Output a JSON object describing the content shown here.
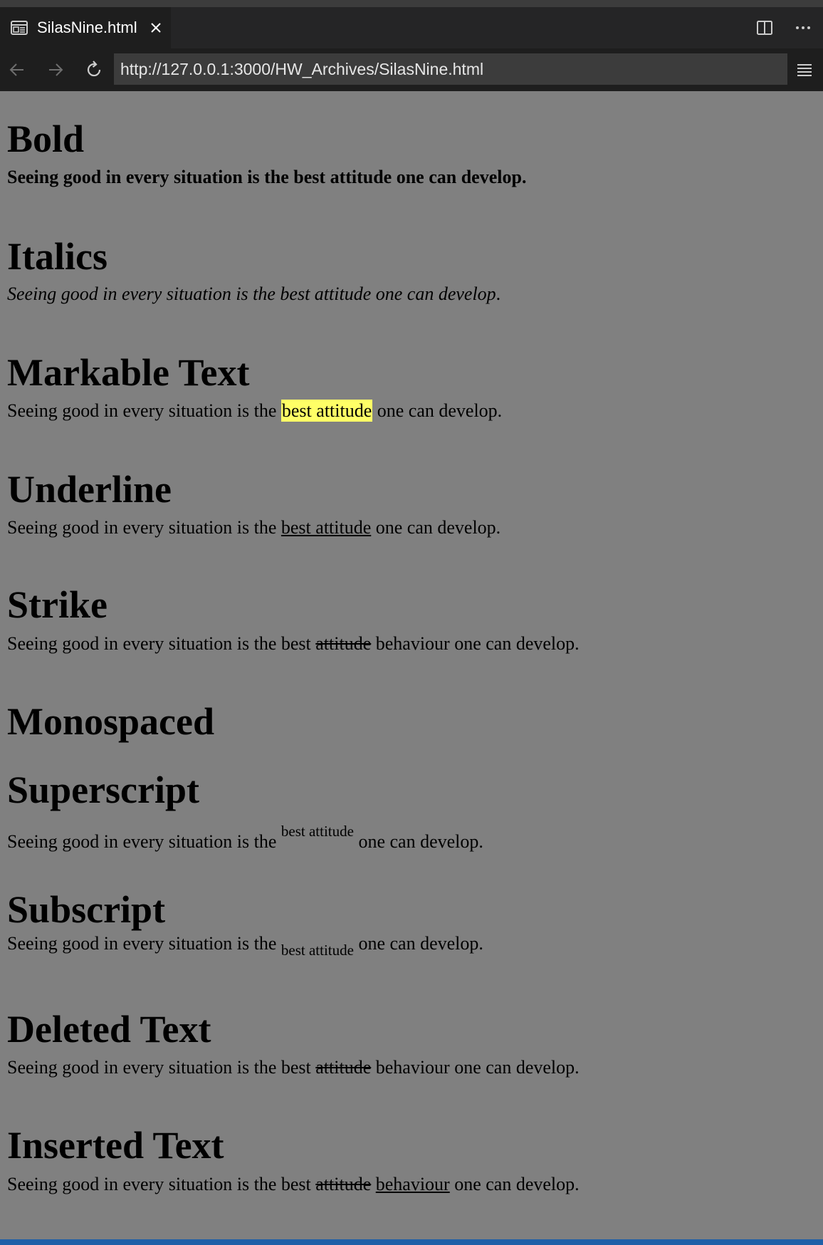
{
  "tab": {
    "title": "SilasNine.html",
    "icon": "preview-icon",
    "close_icon": "close-icon"
  },
  "tab_actions": {
    "split_icon": "split-editor-icon",
    "more_icon": "more-actions-icon"
  },
  "nav": {
    "back_icon": "arrow-left-icon",
    "forward_icon": "arrow-right-icon",
    "reload_icon": "reload-icon",
    "url": "http://127.0.0.1:3000/HW_Archives/SilasNine.html",
    "menu_icon": "hamburger-menu-icon"
  },
  "colors": {
    "page_background": "#808080",
    "highlight": "#ffff66",
    "status_bar": "#1f5fa8"
  },
  "sections": {
    "bold": {
      "heading": "Bold",
      "text": "Seeing good in every situation is the best attitude one can develop."
    },
    "italics": {
      "heading": "Italics",
      "text": "Seeing good in every situation is the best attitude one can develop",
      "trailing": "."
    },
    "mark": {
      "heading": "Markable Text",
      "before": "Seeing good in every situation is the",
      "marked": "best attitude",
      "after": "one can develop."
    },
    "underline": {
      "heading": "Underline",
      "before": "Seeing good in every situation is the",
      "underlined": "best attitude",
      "after": "one can develop."
    },
    "strike": {
      "heading": "Strike",
      "before": "Seeing good in every situation is the best",
      "struck": "attitude",
      "after": "behaviour one can develop."
    },
    "monospaced": {
      "heading": "Monospaced"
    },
    "superscript": {
      "heading": "Superscript",
      "before": "Seeing good in every situation is the",
      "sup": "best attitude",
      "after": "one can develop."
    },
    "subscript": {
      "heading": "Subscript",
      "before": "Seeing good in every situation is the",
      "sub": "best attitude",
      "after": "one can develop."
    },
    "deleted": {
      "heading": "Deleted Text",
      "before": "Seeing good in every situation is the best",
      "deleted": "attitude",
      "after": "behaviour one can develop."
    },
    "inserted": {
      "heading": "Inserted Text",
      "before": "Seeing good in every situation is the best",
      "deleted": "attitude",
      "inserted": "behaviour",
      "after": "one can develop."
    }
  }
}
